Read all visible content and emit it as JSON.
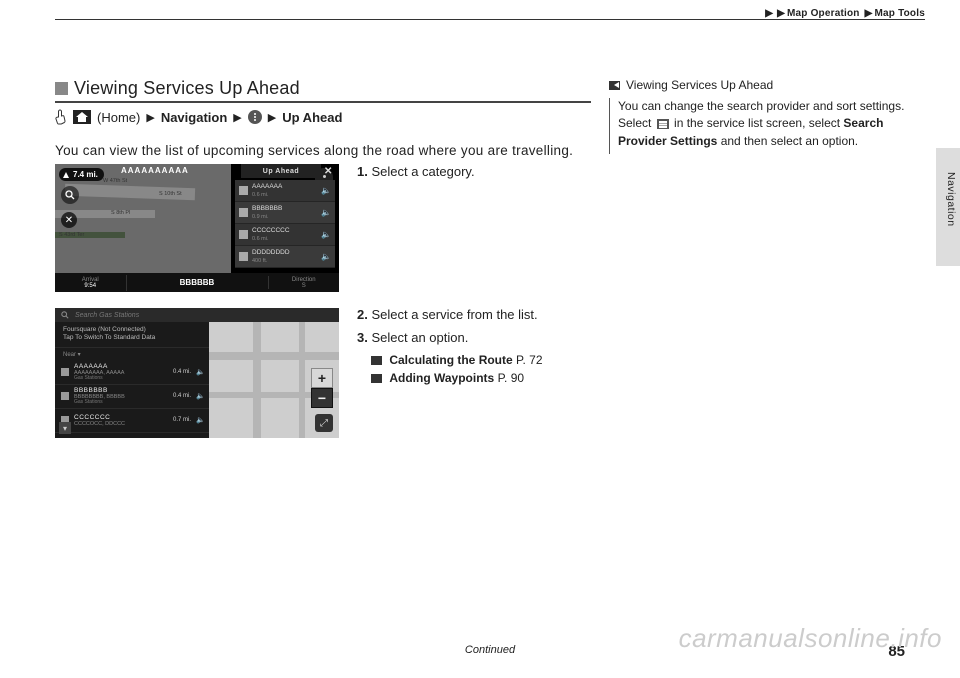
{
  "breadcrumb": {
    "level1": "Map Operation",
    "level2": "Map Tools"
  },
  "side_tab": "Navigation",
  "section": {
    "title": "Viewing Services Up Ahead"
  },
  "path": {
    "home_label": "(Home)",
    "nav_label": "Navigation",
    "up_ahead_label": "Up Ahead"
  },
  "intro": "You can view the list of upcoming services along the road where you are travelling.",
  "steps_block1": {
    "s1_num": "1.",
    "s1_text": "Select a category."
  },
  "steps_block2": {
    "s2_num": "2.",
    "s2_text": "Select a service from the list.",
    "s3_num": "3.",
    "s3_text": "Select an option.",
    "xref1_label": "Calculating the Route",
    "xref1_page": "P. 72",
    "xref2_label": "Adding Waypoints",
    "xref2_page": "P. 90"
  },
  "shot1": {
    "distance_pill": "7.4 mi.",
    "destination": "AAAAAAAAAA",
    "side_header": "Up Ahead",
    "streets": {
      "a": "W 47th St",
      "b": "S 10th St",
      "c": "S 8th Pl",
      "d": "S 43rd Ter"
    },
    "items": [
      {
        "name": "AAAAAAA",
        "sub": "0.6 mi."
      },
      {
        "name": "BBBBBBB",
        "sub": "0.9 mi."
      },
      {
        "name": "CCCCCCCC",
        "sub": "0.6 mi."
      },
      {
        "name": "DDDDDDDD",
        "sub": "400 ft."
      }
    ],
    "bottom": {
      "arrival_lbl": "Arrival",
      "time": "9:54",
      "road": "BBBBBB",
      "dir_lbl": "Direction",
      "dir": "S"
    }
  },
  "shot2": {
    "search_placeholder": "Search Gas Stations",
    "notice_line1": "Foursquare (Not Connected)",
    "notice_line2": "Tap To Switch To Standard Data",
    "near_label": "Near",
    "items": [
      {
        "name": "AAAAAAA",
        "addr": "AAAAAAAA, AAAAA",
        "cat": "Gas Stations",
        "dist": "0.4 mi."
      },
      {
        "name": "BBBBBBB",
        "addr": "BBBBBBBB, BBBBB",
        "cat": "Gas Stations",
        "dist": "0.4 mi."
      },
      {
        "name": "CCCCCCC",
        "addr": "CCCCOCC, DDCCC",
        "cat": "",
        "dist": "0.7 mi."
      }
    ]
  },
  "note": {
    "heading": "Viewing Services Up Ahead",
    "line1": "You can change the search provider and sort settings.",
    "line2a": "Select ",
    "line2b": " in the service list screen, select ",
    "bold1": "Search Provider Settings",
    "line2c": " and then select an option."
  },
  "footer": {
    "continued": "Continued",
    "page": "85"
  },
  "watermark": "carmanualsonline.info"
}
